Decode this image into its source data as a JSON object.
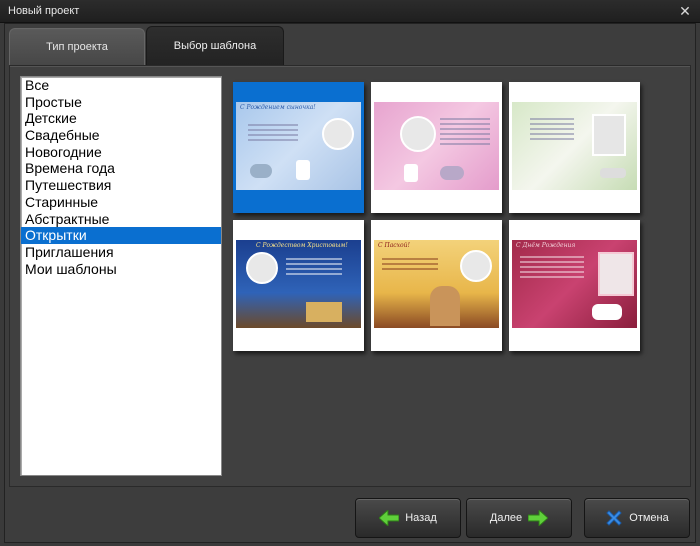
{
  "window": {
    "title": "Новый проект",
    "close_glyph": "✕"
  },
  "tabs": [
    {
      "label": "Тип проекта"
    },
    {
      "label": "Выбор шаблона"
    }
  ],
  "categories": [
    "Все",
    "Простые",
    "Детские",
    "Свадебные",
    "Новогодние",
    "Времена года",
    "Путешествия",
    "Старинные",
    "Абстрактные",
    "Открытки",
    "Приглашения",
    "Мои шаблоны"
  ],
  "selected_category": "Открытки",
  "templates": [
    {
      "icon": "baby-card-thumbnail",
      "caption": "С Рождением сыночка!",
      "selected": true
    },
    {
      "icon": "baby-pink-card-thumbnail",
      "caption": "",
      "selected": false
    },
    {
      "icon": "wedding-card-thumbnail",
      "caption": "",
      "selected": false
    },
    {
      "icon": "christmas-card-thumbnail",
      "caption": "С Рождеством Христовым!",
      "selected": false
    },
    {
      "icon": "easter-card-thumbnail",
      "caption": "С Пасхой!",
      "selected": false
    },
    {
      "icon": "birthday-card-thumbnail",
      "caption": "С Днём Рождения",
      "selected": false
    }
  ],
  "buttons": {
    "back": "Назад",
    "next": "Далее",
    "cancel": "Отмена"
  },
  "colors": {
    "selection": "#0a6fd0",
    "back_arrow": "#5fcf3a",
    "next_arrow": "#5fcf3a",
    "cancel_x": "#3a8ee8"
  }
}
